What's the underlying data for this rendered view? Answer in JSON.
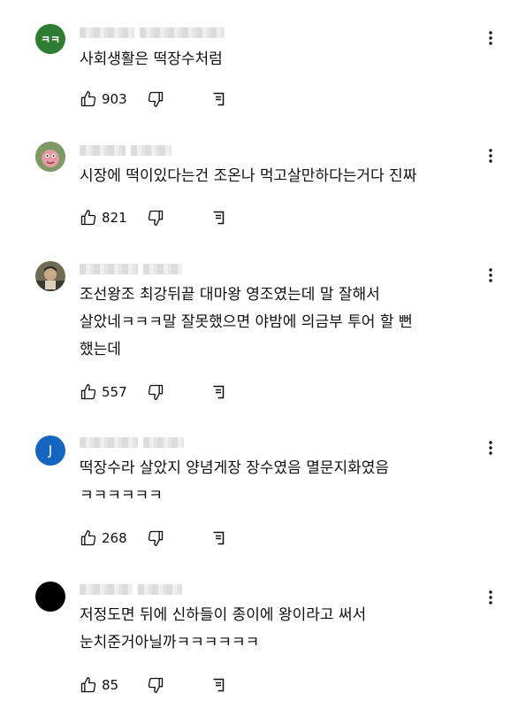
{
  "comments": [
    {
      "avatar_text": "ㅋㅋ",
      "avatar_color": "#2e7d32",
      "text": "사회생활은 떡장수처럼",
      "likes": "903"
    },
    {
      "avatar_text": "",
      "avatar_color": "#6b8f5a",
      "text": "시장에 떡이있다는건 조온나 먹고살만하다는거다 진짜",
      "likes": "821"
    },
    {
      "avatar_text": "",
      "avatar_color": "#5c5a48",
      "text": "조선왕조 최강뒤끝 대마왕 영조였는데 말 잘해서\n살았네ㅋㅋㅋ말 잘못했으면 야밤에 의금부 투어 할 뻔\n했는데",
      "likes": "557"
    },
    {
      "avatar_text": "J",
      "avatar_color": "#1565c0",
      "text": "떡장수라 살았지 양념게장 장수였음 멸문지화였음\nㅋㅋㅋㅋㅋㅋ",
      "likes": "268"
    },
    {
      "avatar_text": "",
      "avatar_color": "#000000",
      "text": "저정도면 뒤에 신하들이 종이에 왕이라고 써서\n눈치준거아닐까ㅋㅋㅋㅋㅋㅋ",
      "likes": "85"
    }
  ],
  "icons": {
    "like": "thumbs-up-icon",
    "dislike": "thumbs-down-icon",
    "reply": "reply-icon",
    "menu": "more-vert-icon"
  }
}
